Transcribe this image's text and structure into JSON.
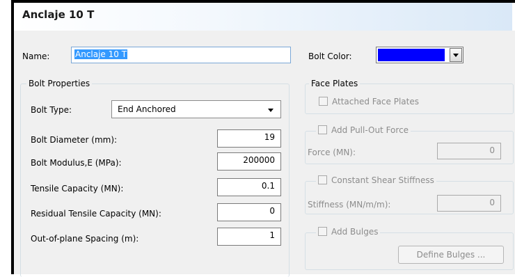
{
  "window": {
    "title": "Anclaje 10 T"
  },
  "name": {
    "label": "Name:",
    "value": "Anclaje 10 T"
  },
  "bolt_color": {
    "label": "Bolt Color:",
    "color": "#0000ff",
    "arrow_icon": "chevron-down-icon"
  },
  "bolt_properties": {
    "title": "Bolt Properties",
    "bolt_type": {
      "label": "Bolt Type:",
      "value": "End Anchored"
    },
    "fields": [
      {
        "label": "Bolt Diameter (mm):",
        "value": "19"
      },
      {
        "label": "Bolt Modulus,E (MPa):",
        "value": "200000"
      },
      {
        "label": "Tensile Capacity (MN):",
        "value": "0.1"
      },
      {
        "label": "Residual Tensile Capacity (MN):",
        "value": "0"
      },
      {
        "label": "Out-of-plane Spacing (m):",
        "value": "1"
      }
    ]
  },
  "face_plates": {
    "title": "Face Plates",
    "attached_label": "Attached Face Plates"
  },
  "pull_out": {
    "checkbox_label": "Add Pull-Out Force",
    "field_label": "Force (MN):",
    "value": "0"
  },
  "shear": {
    "checkbox_label": "Constant Shear Stiffness",
    "field_label": "Stiffness (MN/m/m):",
    "value": "0"
  },
  "bulges": {
    "checkbox_label": "Add Bulges",
    "button_label": "Define Bulges ..."
  }
}
